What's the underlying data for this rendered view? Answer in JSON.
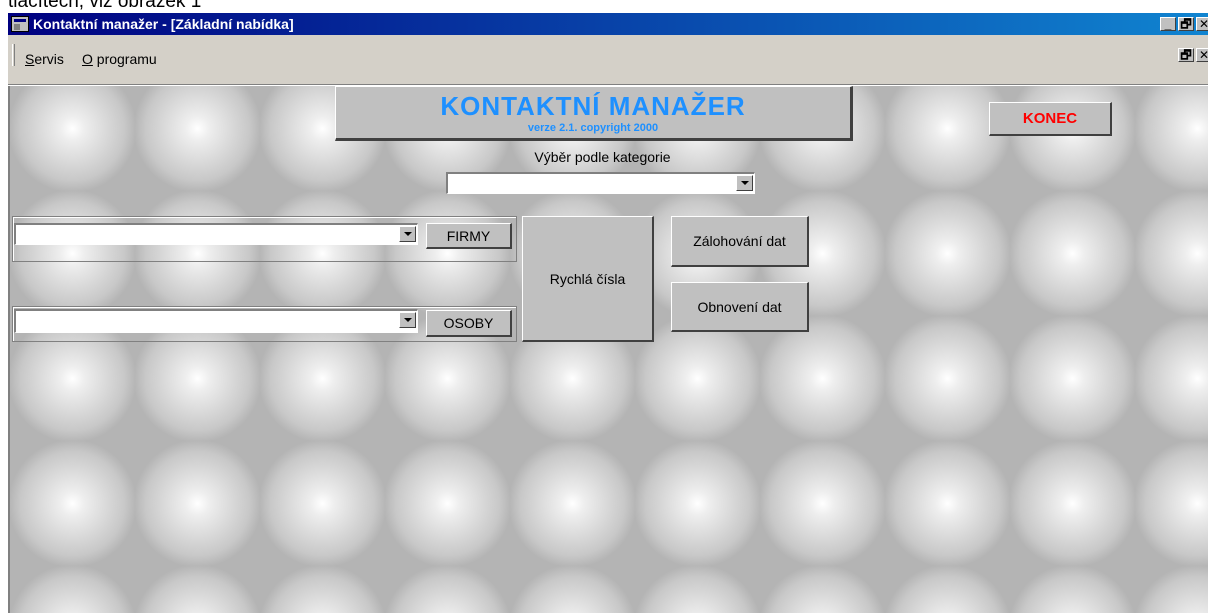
{
  "document_caption": "tlačítech, viz obrázek 1",
  "window": {
    "title": "Kontaktní manažer - [Základní nabídka]",
    "buttons": {
      "minimize": "_",
      "restore": "🗗",
      "close": "✕"
    }
  },
  "menu": {
    "items": [
      {
        "label": "Servis",
        "accel": "S",
        "rest": "ervis"
      },
      {
        "label": "O programu",
        "accel": "O",
        "rest": " programu"
      }
    ]
  },
  "header": {
    "title": "KONTAKTNÍ MANAŽER",
    "subtitle": "verze 2.1. copyright 2000"
  },
  "buttons": {
    "konec": "KONEC",
    "firmy": "FIRMY",
    "osoby": "OSOBY",
    "rychla_cisla": "Rychlá čísla",
    "zalohovani": "Zálohování dat",
    "obnoveni": "Obnovení dat"
  },
  "category": {
    "label": "Výběr podle kategorie",
    "value": ""
  },
  "combos": {
    "firmy_value": "",
    "osoby_value": ""
  },
  "colors": {
    "title_gradient_start": "#000080",
    "title_gradient_end": "#1084d0",
    "header_text": "#1e90ff",
    "konec_text": "#ff0000",
    "face": "#c0c0c0"
  },
  "icons": [
    "app-icon",
    "minimize-icon",
    "restore-icon",
    "close-icon",
    "combo-arrow-icon"
  ]
}
